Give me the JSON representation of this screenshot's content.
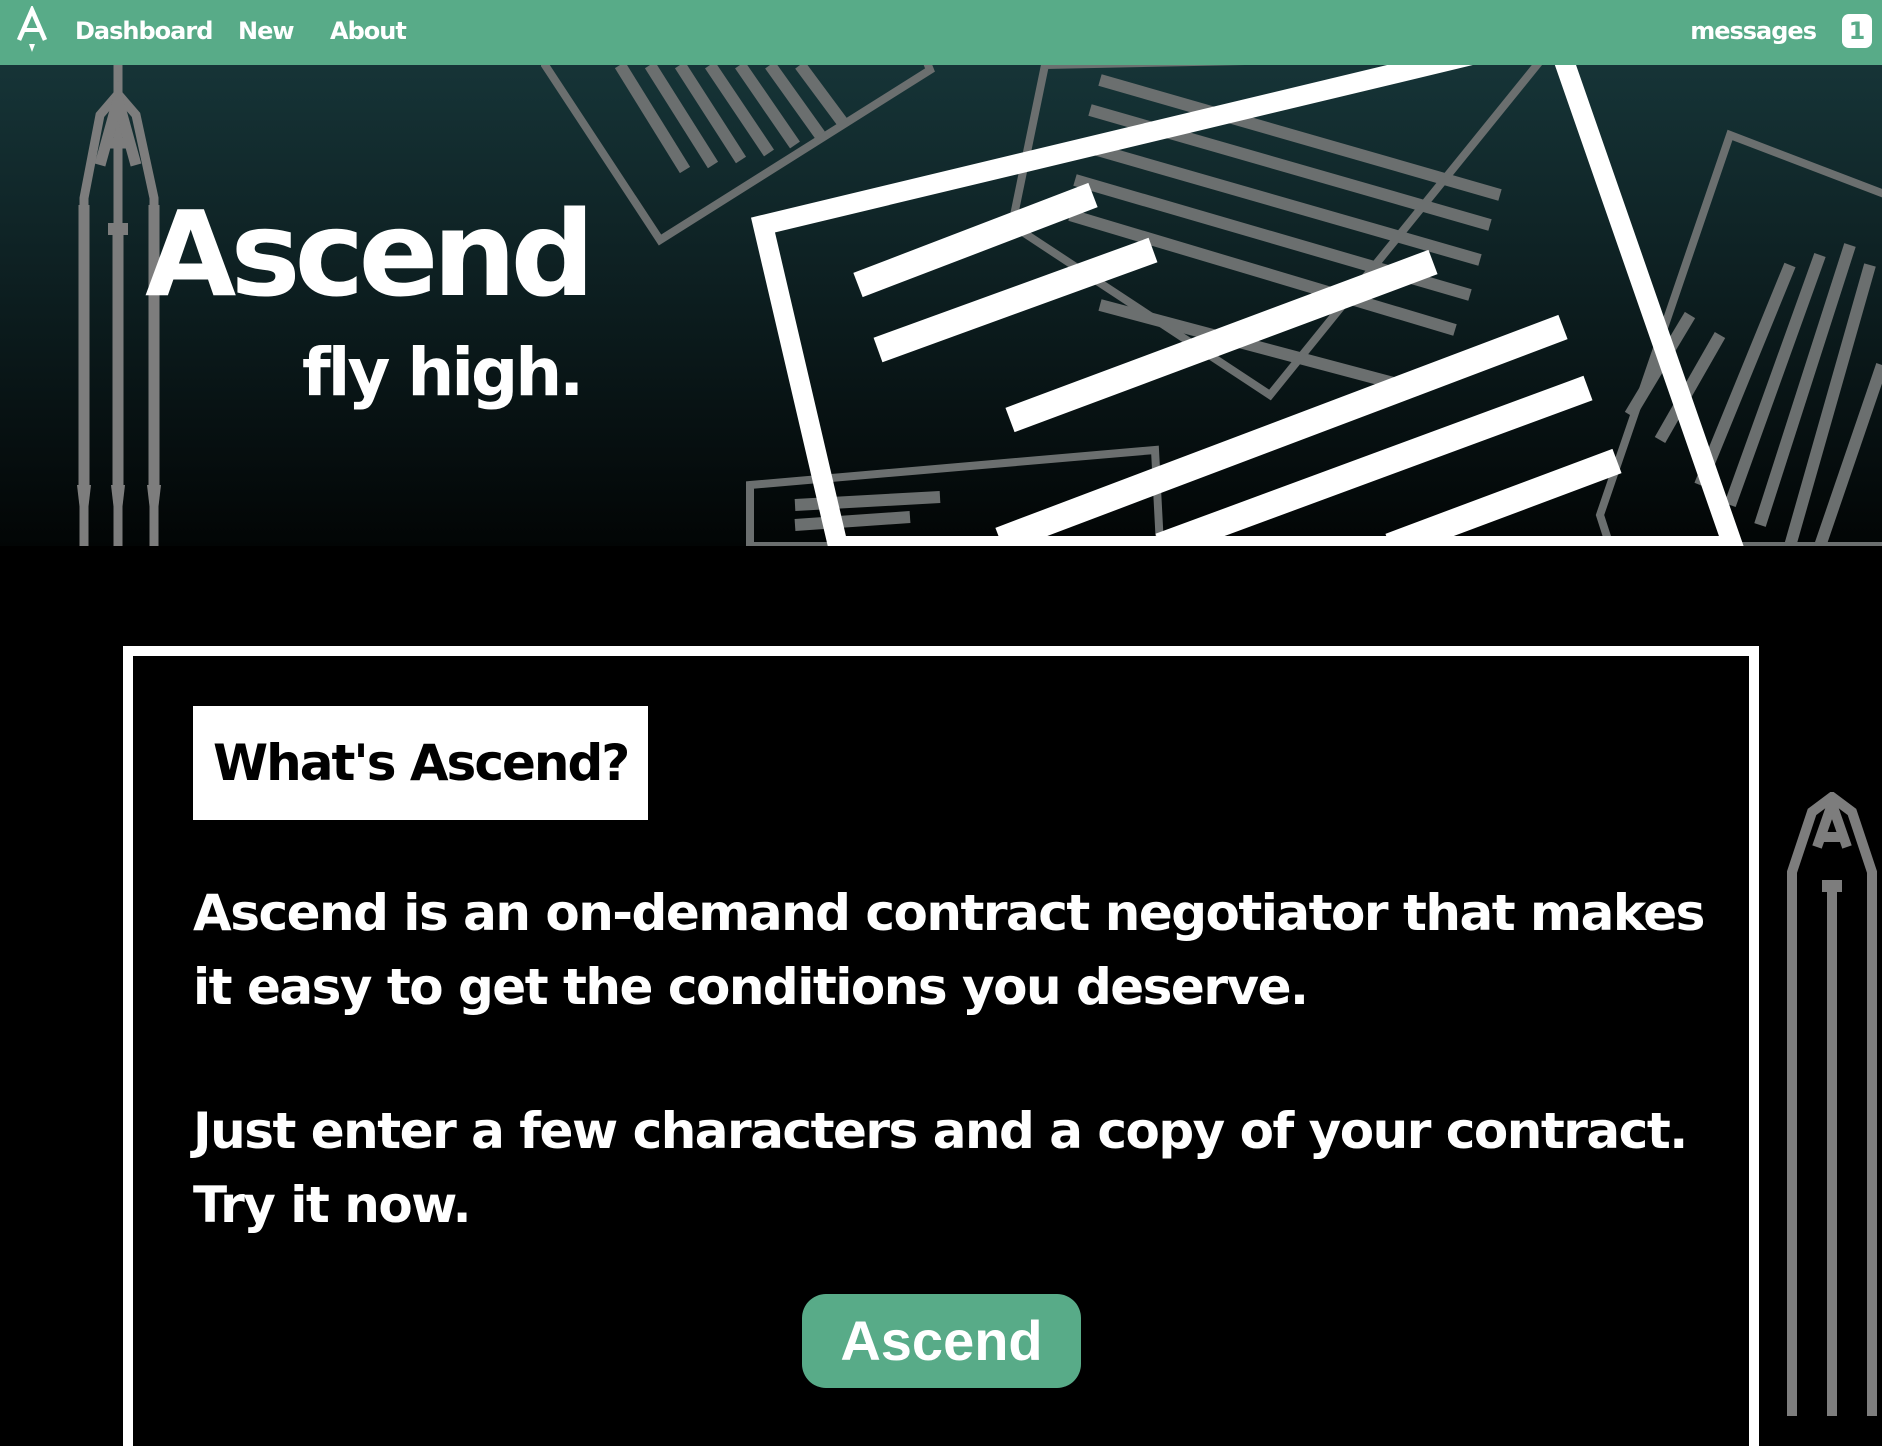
{
  "colors": {
    "accent": "#58ab88",
    "background": "#000000",
    "text": "#ffffff"
  },
  "nav": {
    "logo_icon": "ascend-logo-icon",
    "links": [
      {
        "label": "Dashboard"
      },
      {
        "label": "New"
      },
      {
        "label": "About"
      }
    ],
    "messages_label": "messages",
    "messages_count": "1"
  },
  "hero": {
    "title": "Ascend",
    "tagline": "fly high."
  },
  "about": {
    "heading": "What's Ascend?",
    "paragraph_1": "Ascend is an on-demand contract negotiator that makes it easy to get the conditions you deserve.",
    "paragraph_2": "Just enter a few characters and a copy of your contract. Try it now.",
    "cta_label": "Ascend"
  }
}
